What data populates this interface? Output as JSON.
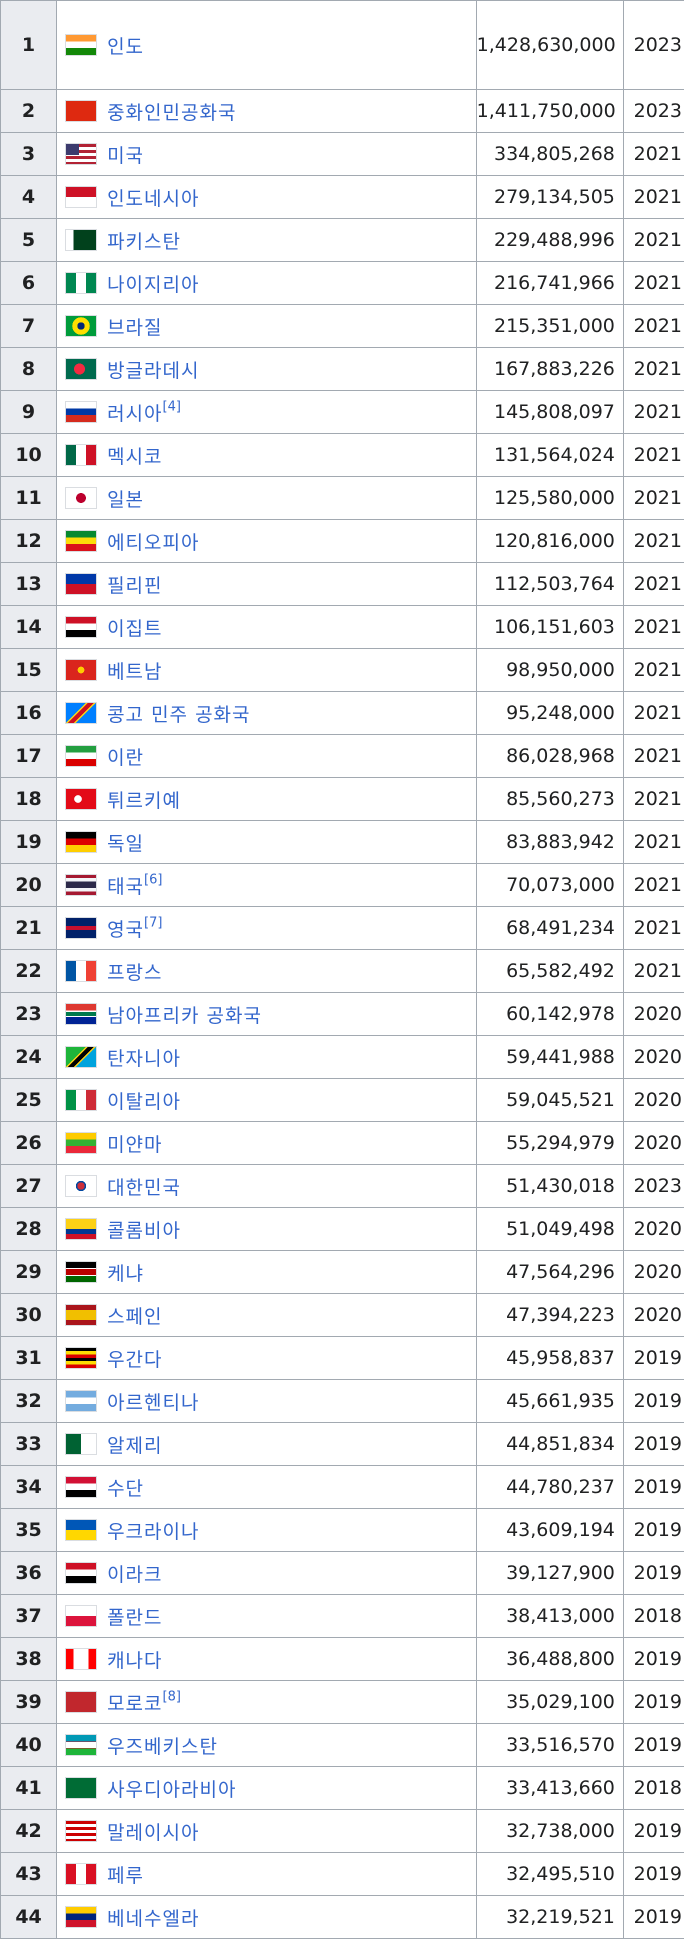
{
  "rows": [
    {
      "rank": "1",
      "country": "인도",
      "note": "",
      "population": "1,428,630,000",
      "year": "2023",
      "flag": "flag-india"
    },
    {
      "rank": "2",
      "country": "중화인민공화국",
      "note": "",
      "population": "1,411,750,000",
      "year": "2023",
      "flag": "flag-china"
    },
    {
      "rank": "3",
      "country": "미국",
      "note": "",
      "population": "334,805,268",
      "year": "2021",
      "flag": "flag-usa"
    },
    {
      "rank": "4",
      "country": "인도네시아",
      "note": "",
      "population": "279,134,505",
      "year": "2021",
      "flag": "flag-indonesia"
    },
    {
      "rank": "5",
      "country": "파키스탄",
      "note": "",
      "population": "229,488,996",
      "year": "2021",
      "flag": "flag-pakistan"
    },
    {
      "rank": "6",
      "country": "나이지리아",
      "note": "",
      "population": "216,741,966",
      "year": "2021",
      "flag": "flag-nigeria"
    },
    {
      "rank": "7",
      "country": "브라질",
      "note": "",
      "population": "215,351,000",
      "year": "2021",
      "flag": "flag-brazil"
    },
    {
      "rank": "8",
      "country": "방글라데시",
      "note": "",
      "population": "167,883,226",
      "year": "2021",
      "flag": "flag-bangladesh"
    },
    {
      "rank": "9",
      "country": "러시아",
      "note": "[4]",
      "population": "145,808,097",
      "year": "2021",
      "flag": "flag-russia"
    },
    {
      "rank": "10",
      "country": "멕시코",
      "note": "",
      "population": "131,564,024",
      "year": "2021",
      "flag": "flag-mexico"
    },
    {
      "rank": "11",
      "country": "일본",
      "note": "",
      "population": "125,580,000",
      "year": "2021",
      "flag": "flag-japan"
    },
    {
      "rank": "12",
      "country": "에티오피아",
      "note": "",
      "population": "120,816,000",
      "year": "2021",
      "flag": "flag-ethiopia"
    },
    {
      "rank": "13",
      "country": "필리핀",
      "note": "",
      "population": "112,503,764",
      "year": "2021",
      "flag": "flag-philippines"
    },
    {
      "rank": "14",
      "country": "이집트",
      "note": "",
      "population": "106,151,603",
      "year": "2021",
      "flag": "flag-egypt"
    },
    {
      "rank": "15",
      "country": "베트남",
      "note": "",
      "population": "98,950,000",
      "year": "2021",
      "flag": "flag-vietnam"
    },
    {
      "rank": "16",
      "country": "콩고 민주 공화국",
      "note": "",
      "population": "95,248,000",
      "year": "2021",
      "flag": "flag-dr-congo"
    },
    {
      "rank": "17",
      "country": "이란",
      "note": "",
      "population": "86,028,968",
      "year": "2021",
      "flag": "flag-iran"
    },
    {
      "rank": "18",
      "country": "튀르키예",
      "note": "",
      "population": "85,560,273",
      "year": "2021",
      "flag": "flag-turkey"
    },
    {
      "rank": "19",
      "country": "독일",
      "note": "",
      "population": "83,883,942",
      "year": "2021",
      "flag": "flag-germany"
    },
    {
      "rank": "20",
      "country": "태국",
      "note": "[6]",
      "population": "70,073,000",
      "year": "2021",
      "flag": "flag-thailand"
    },
    {
      "rank": "21",
      "country": "영국",
      "note": "[7]",
      "population": "68,491,234",
      "year": "2021",
      "flag": "flag-uk"
    },
    {
      "rank": "22",
      "country": "프랑스",
      "note": "",
      "population": "65,582,492",
      "year": "2021",
      "flag": "flag-france"
    },
    {
      "rank": "23",
      "country": "남아프리카 공화국",
      "note": "",
      "population": "60,142,978",
      "year": "2020",
      "flag": "flag-south-africa"
    },
    {
      "rank": "24",
      "country": "탄자니아",
      "note": "",
      "population": "59,441,988",
      "year": "2020",
      "flag": "flag-tanzania"
    },
    {
      "rank": "25",
      "country": "이탈리아",
      "note": "",
      "population": "59,045,521",
      "year": "2020",
      "flag": "flag-italy"
    },
    {
      "rank": "26",
      "country": "미얀마",
      "note": "",
      "population": "55,294,979",
      "year": "2020",
      "flag": "flag-myanmar"
    },
    {
      "rank": "27",
      "country": "대한민국",
      "note": "",
      "population": "51,430,018",
      "year": "2023",
      "flag": "flag-south-korea"
    },
    {
      "rank": "28",
      "country": "콜롬비아",
      "note": "",
      "population": "51,049,498",
      "year": "2020",
      "flag": "flag-colombia"
    },
    {
      "rank": "29",
      "country": "케냐",
      "note": "",
      "population": "47,564,296",
      "year": "2020",
      "flag": "flag-kenya"
    },
    {
      "rank": "30",
      "country": "스페인",
      "note": "",
      "population": "47,394,223",
      "year": "2020",
      "flag": "flag-spain"
    },
    {
      "rank": "31",
      "country": "우간다",
      "note": "",
      "population": "45,958,837",
      "year": "2019",
      "flag": "flag-uganda"
    },
    {
      "rank": "32",
      "country": "아르헨티나",
      "note": "",
      "population": "45,661,935",
      "year": "2019",
      "flag": "flag-argentina"
    },
    {
      "rank": "33",
      "country": "알제리",
      "note": "",
      "population": "44,851,834",
      "year": "2019",
      "flag": "flag-algeria"
    },
    {
      "rank": "34",
      "country": "수단",
      "note": "",
      "population": "44,780,237",
      "year": "2019",
      "flag": "flag-sudan"
    },
    {
      "rank": "35",
      "country": "우크라이나",
      "note": "",
      "population": "43,609,194",
      "year": "2019",
      "flag": "flag-ukraine"
    },
    {
      "rank": "36",
      "country": "이라크",
      "note": "",
      "population": "39,127,900",
      "year": "2019",
      "flag": "flag-iraq"
    },
    {
      "rank": "37",
      "country": "폴란드",
      "note": "",
      "population": "38,413,000",
      "year": "2018",
      "flag": "flag-poland"
    },
    {
      "rank": "38",
      "country": "캐나다",
      "note": "",
      "population": "36,488,800",
      "year": "2019",
      "flag": "flag-canada"
    },
    {
      "rank": "39",
      "country": "모로코",
      "note": "[8]",
      "population": "35,029,100",
      "year": "2019",
      "flag": "flag-morocco"
    },
    {
      "rank": "40",
      "country": "우즈베키스탄",
      "note": "",
      "population": "33,516,570",
      "year": "2019",
      "flag": "flag-uzbekistan"
    },
    {
      "rank": "41",
      "country": "사우디아라비아",
      "note": "",
      "population": "33,413,660",
      "year": "2018",
      "flag": "flag-saudi-arabia"
    },
    {
      "rank": "42",
      "country": "말레이시아",
      "note": "",
      "population": "32,738,000",
      "year": "2019",
      "flag": "flag-malaysia"
    },
    {
      "rank": "43",
      "country": "페루",
      "note": "",
      "population": "32,495,510",
      "year": "2019",
      "flag": "flag-peru"
    },
    {
      "rank": "44",
      "country": "베네수엘라",
      "note": "",
      "population": "32,219,521",
      "year": "2019",
      "flag": "flag-venezuela"
    }
  ]
}
